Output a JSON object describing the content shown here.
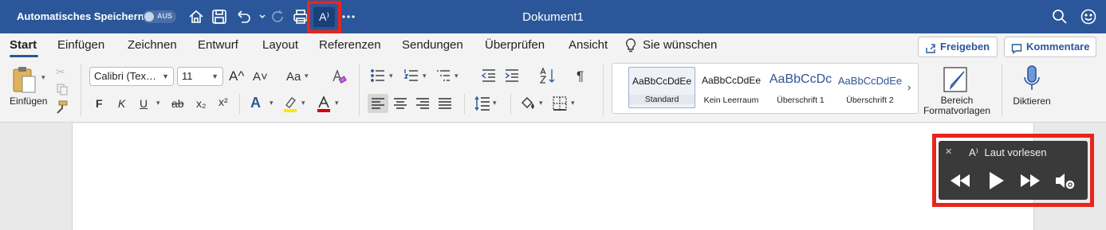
{
  "titlebar": {
    "autosave_label": "Automatisches Speichern",
    "autosave_state": "AUS",
    "document_title": "Dokument1",
    "read_aloud_glyph": "A⁾"
  },
  "tabs": [
    {
      "label": "Start",
      "active": true
    },
    {
      "label": "Einfügen"
    },
    {
      "label": "Zeichnen"
    },
    {
      "label": "Entwurf"
    },
    {
      "label": "Layout"
    },
    {
      "label": "Referenzen"
    },
    {
      "label": "Sendungen"
    },
    {
      "label": "Überprüfen"
    },
    {
      "label": "Ansicht"
    },
    {
      "label": "Sie wünschen"
    }
  ],
  "actions": {
    "share_label": "Freigeben",
    "comments_label": "Kommentare"
  },
  "ribbon": {
    "paste_label": "Einfügen",
    "font_name": "Calibri (Tex…",
    "font_size": "11",
    "grow_font": "A^",
    "shrink_font": "A˅",
    "change_case": "Aa",
    "bold": "F",
    "italic": "K",
    "underline": "U",
    "strike": "ab",
    "subscript": "x₂",
    "superscript": "x²",
    "styles": [
      {
        "preview": "AaBbCcDdEe",
        "name": "Standard"
      },
      {
        "preview": "AaBbCcDdEe",
        "name": "Kein Leerraum"
      },
      {
        "preview": "AaBbCcDc",
        "name": "Überschrift 1"
      },
      {
        "preview": "AaBbCcDdEe",
        "name": "Überschrift 2"
      }
    ],
    "styles_pane_label_1": "Bereich",
    "styles_pane_label_2": "Formatvorlagen",
    "dictate_label": "Diktieren"
  },
  "read_aloud": {
    "title": "Laut vorlesen",
    "close_glyph": "✕"
  },
  "colors": {
    "accent": "#2b579a",
    "highlight_box": "#e8251c",
    "highlight_yellow": "#ffe600",
    "font_color_red": "#d40000"
  }
}
